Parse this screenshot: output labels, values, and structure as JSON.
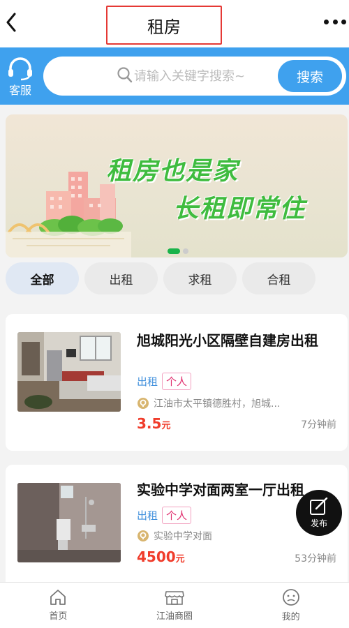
{
  "header": {
    "title": "租房"
  },
  "searchbar": {
    "service_label": "客服",
    "placeholder": "请输入关键字搜索~",
    "button_label": "搜索"
  },
  "banner": {
    "line1": "租房也是家",
    "line2": "长租即常住",
    "slide_count": 2,
    "active_slide": 1
  },
  "tabs": [
    {
      "label": "全部",
      "active": true
    },
    {
      "label": "出租",
      "active": false
    },
    {
      "label": "求租",
      "active": false
    },
    {
      "label": "合租",
      "active": false
    }
  ],
  "listings": [
    {
      "title": "旭城阳光小区隔壁自建房出租",
      "type": "出租",
      "poster": "个人",
      "location": "江油市太平镇德胜村，旭城...",
      "price": "3.5",
      "price_unit": "元",
      "time": "7分钟前"
    },
    {
      "title": "实验中学对面两室一厅出租",
      "type": "出租",
      "poster": "个人",
      "location": "实验中学对面",
      "price": "4500",
      "price_unit": "元",
      "time": "53分钟前"
    }
  ],
  "fab": {
    "label": "发布"
  },
  "bottom_nav": [
    {
      "label": "首页",
      "icon": "home-icon"
    },
    {
      "label": "江油商圈",
      "icon": "store-icon"
    },
    {
      "label": "我的",
      "icon": "profile-face-icon"
    }
  ],
  "colors": {
    "primary_blue": "#3fa1ee",
    "price_red": "#f03c2b",
    "tag_pink": "#e0306f",
    "banner_green": "#3fbc3f"
  }
}
